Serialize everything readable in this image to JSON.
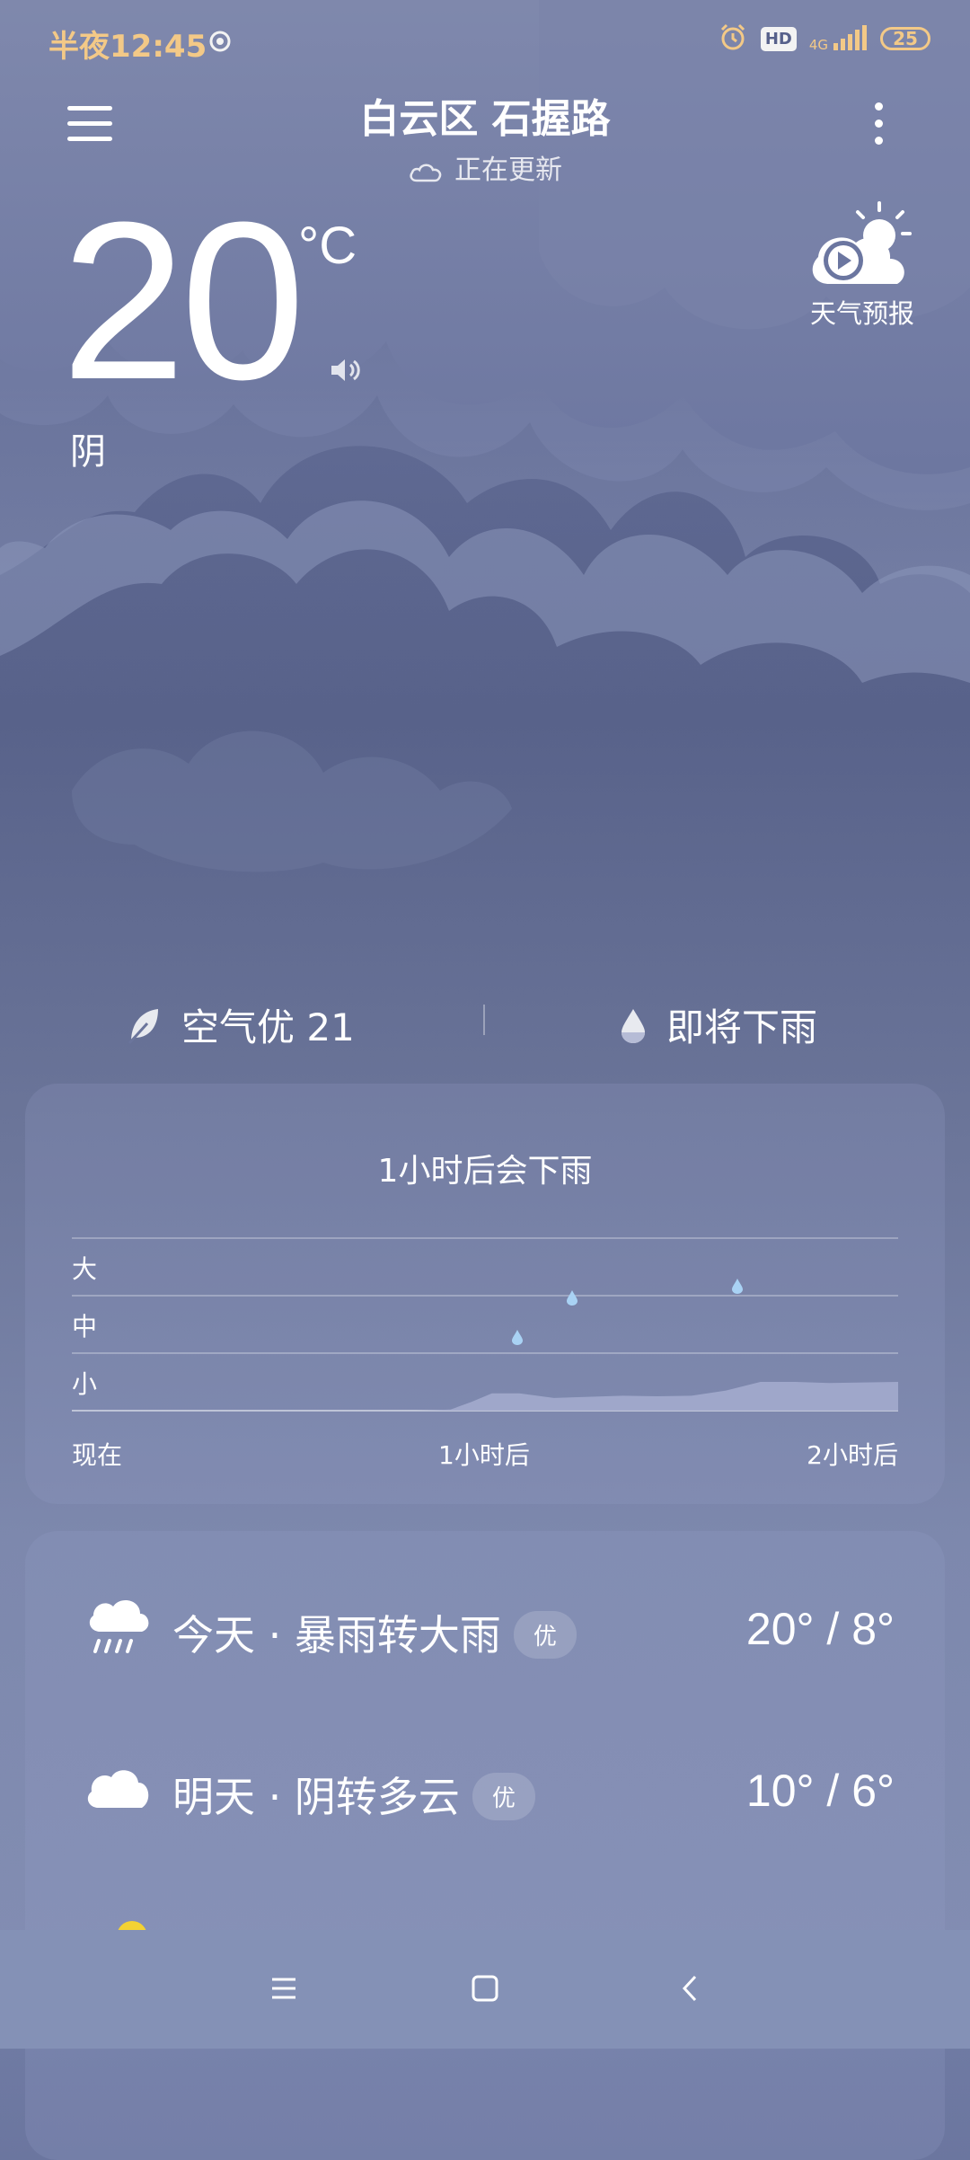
{
  "status_bar": {
    "time": "半夜12:45",
    "hd": "HD",
    "network": "4G",
    "battery": "25"
  },
  "header": {
    "location": "白云区 石握路",
    "update_status": "正在更新"
  },
  "current": {
    "temperature": "20",
    "unit": "°C",
    "condition": "阴"
  },
  "forecast_video": {
    "label": "天气预报"
  },
  "indicators": {
    "air_quality": "空气优 21",
    "rain_notice": "即将下雨"
  },
  "precipitation": {
    "title": "1小时后会下雨",
    "levels": [
      "大",
      "中",
      "小"
    ],
    "x_labels": [
      "现在",
      "1小时后",
      "2小时后"
    ]
  },
  "chart_data": {
    "type": "area",
    "title": "1小时后会下雨",
    "x_labels": [
      "现在",
      "1小时后",
      "2小时后"
    ],
    "y_levels": [
      "小",
      "中",
      "大"
    ],
    "ylim": [
      0,
      3
    ],
    "x_minutes": [
      0,
      10,
      20,
      30,
      40,
      50,
      55,
      58,
      61,
      65,
      70,
      75,
      80,
      85,
      90,
      95,
      100,
      105,
      110,
      115,
      120
    ],
    "intensity": [
      0,
      0,
      0,
      0,
      0,
      0,
      0.02,
      0.15,
      0.3,
      0.3,
      0.22,
      0.24,
      0.26,
      0.25,
      0.26,
      0.35,
      0.5,
      0.5,
      0.48,
      0.49,
      0.5
    ],
    "grid": true,
    "colors": {
      "fill": "#a3abcd",
      "drop": "#a9d2f4"
    }
  },
  "daily": [
    {
      "day": "今天",
      "condition": "暴雨转大雨",
      "aqi": "优",
      "temps": "20° / 8°",
      "icon": "heavy-rain-icon"
    },
    {
      "day": "明天",
      "condition": "阴转多云",
      "aqi": "优",
      "temps": "10° / 6°",
      "icon": "cloud-icon"
    }
  ],
  "nav": [
    "menu-icon",
    "home-icon",
    "back-icon"
  ]
}
